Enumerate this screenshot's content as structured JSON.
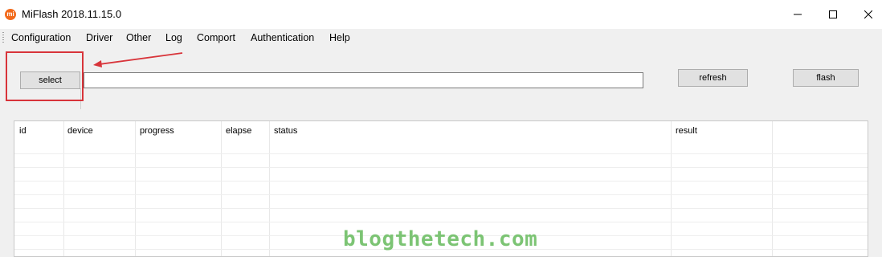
{
  "window": {
    "title": "MiFlash 2018.11.15.0",
    "icon": "xiaomi-mi-logo",
    "icon_text": "mi",
    "controls": [
      "minimize-icon",
      "maximize-icon",
      "close-icon"
    ]
  },
  "menu": {
    "items": [
      {
        "label": "Configuration"
      },
      {
        "label": "Driver"
      },
      {
        "label": "Other"
      },
      {
        "label": "Log"
      },
      {
        "label": "Comport"
      },
      {
        "label": "Authentication"
      },
      {
        "label": "Help"
      }
    ]
  },
  "toolbar": {
    "select_label": "select",
    "path_value": "",
    "refresh_label": "refresh",
    "flash_label": "flash"
  },
  "annotation": {
    "highlight_color": "#d8343a",
    "arrow_color": "#d8343a"
  },
  "grid": {
    "columns": [
      {
        "label": "id"
      },
      {
        "label": "device"
      },
      {
        "label": "progress"
      },
      {
        "label": "elapse"
      },
      {
        "label": "status"
      },
      {
        "label": "result"
      }
    ],
    "rows": []
  },
  "watermark": "blogthetech.com",
  "colors": {
    "window_bg": "#f0f0f0",
    "button_bg": "#e1e1e1",
    "watermark": "#7cc474"
  }
}
